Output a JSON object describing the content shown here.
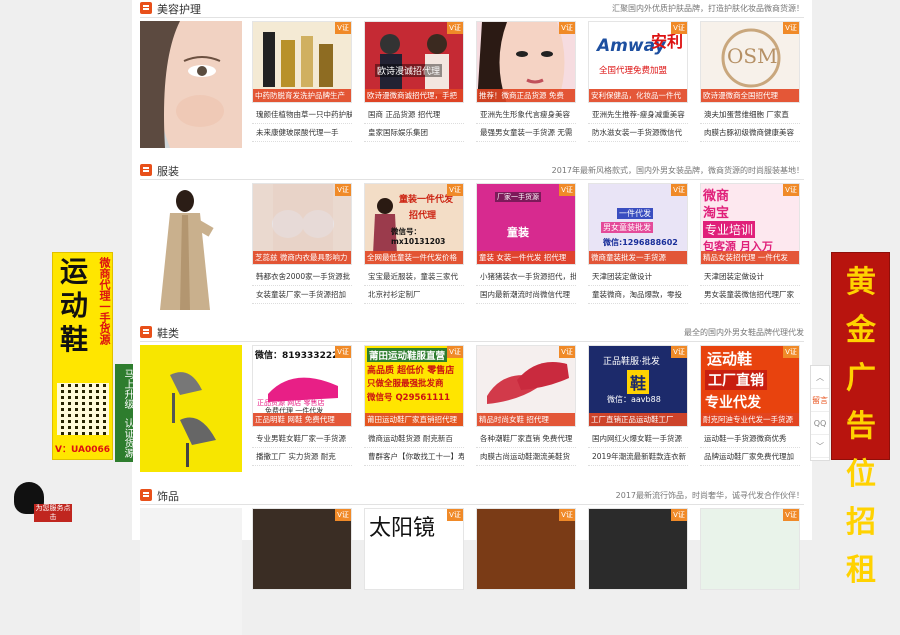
{
  "sections": [
    {
      "title": "美容护理",
      "slogan": "汇聚国内外优质护肤品牌，打造护肤化妆品微商货源！",
      "cards": [
        {
          "banner": "中药防脱育发洗护品牌生产",
          "tag": "V证",
          "links": [
            "瑰颜佳植物由草一只中药护肤",
            "未来康健玻尿酸代理一手"
          ]
        },
        {
          "banner": "欧诗漫微商诚招代理，手把",
          "tag": "V证",
          "links": [
            "国商 正品货源 招代理",
            "皇家国际娱乐集团"
          ]
        },
        {
          "banner": "推荐！微商正品货源 免费",
          "tag": "V证",
          "links": [
            "亚洲先生形象代言瘦身美容",
            "最强男女童装一手货源 无需"
          ]
        },
        {
          "banner": "安利保健品，化妆品一件代",
          "tag": "V证",
          "links": [
            "亚洲先生推荐-瘦身减重美容",
            "防水滋女装一手货源微信代"
          ]
        },
        {
          "banner": "欧诗漫微商全国招代理",
          "tag": "V证",
          "links": [
            "澳夫加蛋营维细胞 厂家直",
            "肉膜古豚初级微商健康美容"
          ]
        }
      ]
    },
    {
      "title": "服装",
      "slogan": "2017年最新风格款式，国内外男女装品牌，微商货源的时尚服装基地！",
      "cards": [
        {
          "banner": "芝蕊兹 微商内衣最具影响力",
          "tag": "V证",
          "links": [
            "韩都衣舍2000家一手货源批",
            "女装童装厂家一手货源招加"
          ]
        },
        {
          "banner": "全网最低童装一件代发价格",
          "tag": "V证",
          "links": [
            "宝宝最近服装，童装三家代",
            "北京衬衫定制厂"
          ]
        },
        {
          "banner": "童装 女装一件代发 招代理",
          "tag": "V证",
          "links": [
            "小猪猪装衣一手货源招代，批",
            "国内最新潮流时尚微信代理"
          ]
        },
        {
          "banner": "微商童装批发一手货源",
          "tag": "V证",
          "links": [
            "天津团装定做设计",
            "童装微商，淘品爆款，零投"
          ]
        },
        {
          "banner": "精品女装招代理 一件代发",
          "tag": "V证",
          "links": [
            "天津团装定做设计",
            "男女装童装微信招代理厂家"
          ]
        }
      ]
    },
    {
      "title": "鞋类",
      "slogan": "最全的国内外男女鞋品牌代理代发",
      "cards": [
        {
          "banner": "正品明鞋 网鞋 免费代理",
          "tag": "V证",
          "links": [
            "专业男鞋女鞋厂家一手货源",
            "播撒工厂 实力货源 耐克"
          ]
        },
        {
          "banner": "莆田运动鞋厂家直销招代理",
          "tag": "V证",
          "links": [
            "微商运动鞋货源 耐克新百",
            "曹群客户【你敢找工十一】寿"
          ]
        },
        {
          "banner": "精品时尚女鞋 招代理",
          "tag": "V证",
          "links": [
            "各种潮鞋厂家直销 免费代理",
            "肉膜古尚运动鞋潮流美鞋货"
          ]
        },
        {
          "banner": "工厂直销正品运动鞋工厂",
          "tag": "V证",
          "links": [
            "国内网红火爆女鞋一手货源",
            "2019年潮流最新鞋款连衣新"
          ]
        },
        {
          "banner": "耐克阿迪专业代发一手货源",
          "tag": "V证",
          "links": [
            "运动鞋一手货源微商优秀",
            "品牌运动鞋厂家免费代理加"
          ]
        }
      ]
    },
    {
      "title": "饰品",
      "slogan": "2017最新流行饰品，时尚奢华，诚寻代发合作伙伴！",
      "cards": [
        {
          "banner": "",
          "tag": "V证",
          "links": []
        },
        {
          "banner": "",
          "tag": "V证",
          "links": []
        },
        {
          "banner": "",
          "tag": "V证",
          "links": []
        },
        {
          "banner": "",
          "tag": "V证",
          "links": []
        },
        {
          "banner": "",
          "tag": "V证",
          "links": []
        }
      ]
    }
  ],
  "thumb_text": {
    "s1c2": "欧诗漫诚招代理",
    "s1c4a": "Amway",
    "s1c4b": "安利",
    "s1c4c": "全国代理免费加盟",
    "s1c5": "OSM",
    "s2c3a": "童装一件代发",
    "s2c3b": "招代理",
    "s2c3c": "微信号：mx10131203",
    "s2c4a": "厂家一手货源",
    "s2c4b": "童装",
    "s2c5a": "一件代发",
    "s2c5b": "男女童装批发",
    "s2c5c": "微信:1296888602",
    "s2c6a": "微商",
    "s2c6b": "淘宝",
    "s2c6c": "专业培训",
    "s2c6d": "包客源 月入万",
    "s3c2a": "微信：819333222",
    "s3c2b": "正品货源 网店 零售店",
    "s3c2c": "免费代理 一件代发",
    "s3c3a": "莆田运动鞋服直营",
    "s3c3b": "高品质 超低价 零售店",
    "s3c3c": "只做全服最强批发商",
    "s3c3d": "微信号 Q29561111",
    "s3c5a": "正品鞋服·批发",
    "s3c5b": "鞋",
    "s3c5c": "微信：aavb88",
    "s3c6a": "运动鞋",
    "s3c6b": "工厂直销",
    "s3c6c": "专业代发",
    "s4c3": "太阳镜"
  },
  "left_ad": {
    "big_text": "运动鞋",
    "sub_text": "微商代理一手货源",
    "vid": "V：UA0066",
    "tab1": "马上升级",
    "tab2": "认证货源"
  },
  "right_ad": {
    "text": "黄金广告位招租"
  },
  "toolbar": {
    "up": "︿",
    "feedback": "留言",
    "qq": "QQ",
    "down": "﹀"
  },
  "qq_float": {
    "text": "为您服务点击"
  }
}
